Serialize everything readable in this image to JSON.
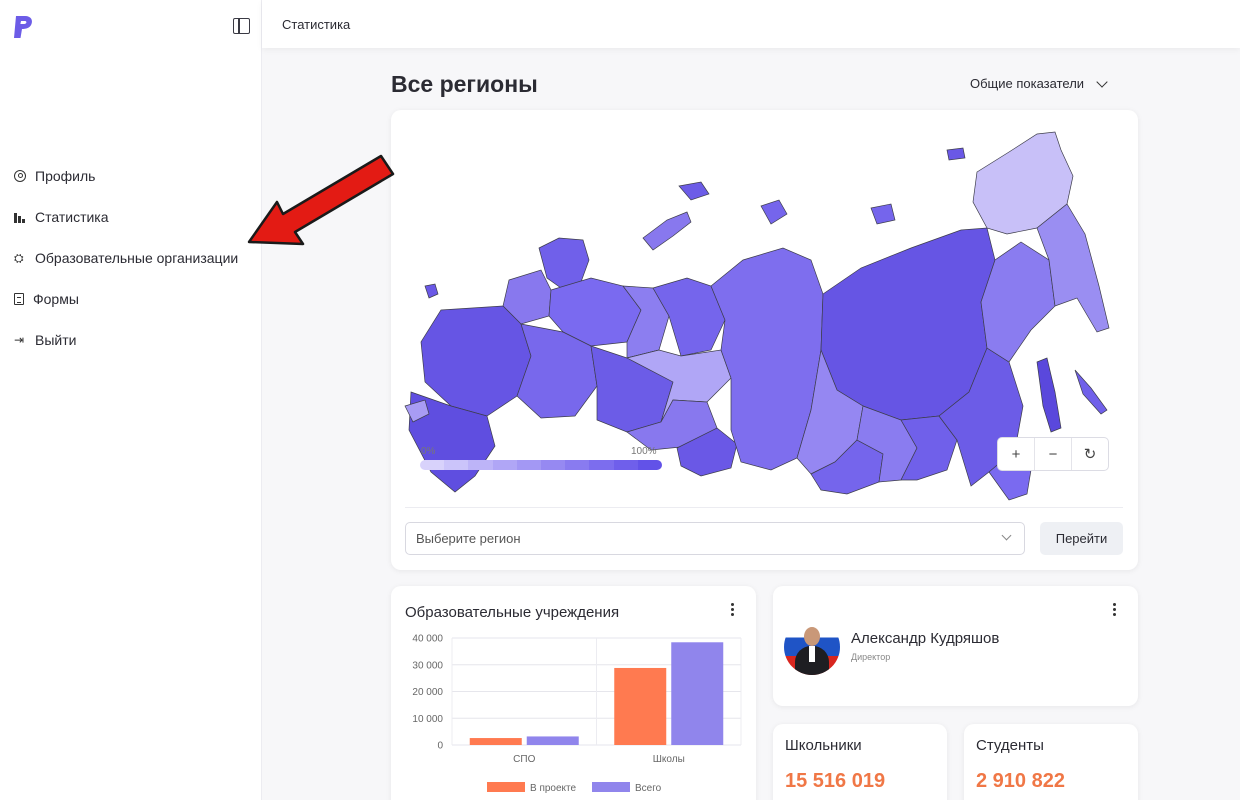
{
  "sidebar": {
    "items": [
      {
        "label": "Профиль",
        "icon": "profile-icon"
      },
      {
        "label": "Статистика",
        "icon": "stats-icon"
      },
      {
        "label": "Образовательные организации",
        "icon": "graduation-cap-icon"
      },
      {
        "label": "Формы",
        "icon": "document-icon"
      },
      {
        "label": "Выйти",
        "icon": "logout-icon"
      }
    ]
  },
  "header": {
    "title": "Статистика"
  },
  "main": {
    "title": "Все регионы",
    "filter_label": "Общие показатели",
    "map": {
      "legend_min": "0%",
      "legend_max": "100%",
      "zoom_in": "+",
      "zoom_out": "−",
      "reset": "↻",
      "region_placeholder": "Выберите регион",
      "go_button": "Перейти"
    },
    "institutions": {
      "title": "Образовательные учреждения"
    },
    "person": {
      "name": "Александр Кудряшов",
      "role": "Директор"
    },
    "stats": [
      {
        "label": "Школьники",
        "value": "15 516 019"
      },
      {
        "label": "Студенты",
        "value": "2 910 822"
      }
    ]
  },
  "colors": {
    "accent": "#7a6af0",
    "bar_project": "#ff7a50",
    "bar_total": "#9085ec",
    "stat_value": "#f07746",
    "annotation_arrow": "#e31b14"
  },
  "chart_data": {
    "type": "bar",
    "categories": [
      "СПО",
      "Школы"
    ],
    "series": [
      {
        "name": "В проекте",
        "values": [
          2600,
          28800
        ]
      },
      {
        "name": "Всего",
        "values": [
          3200,
          38400
        ]
      }
    ],
    "yticks": [
      "40 000",
      "30 000",
      "20 000",
      "10 000",
      "0"
    ],
    "ylim": [
      0,
      40000
    ],
    "legend": "bottom"
  }
}
